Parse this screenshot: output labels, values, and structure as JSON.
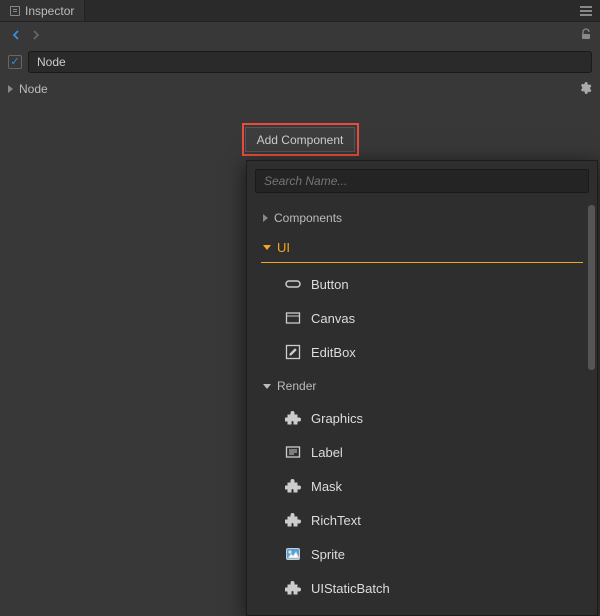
{
  "panel": {
    "title": "Inspector"
  },
  "node": {
    "name": "Node",
    "section": "Node",
    "checked": true
  },
  "addComponent": {
    "label": "Add Component"
  },
  "dropdown": {
    "search_placeholder": "Search Name...",
    "categories": {
      "components": "Components",
      "ui": "UI",
      "render": "Render"
    },
    "ui_items": [
      {
        "label": "Button",
        "icon": "button"
      },
      {
        "label": "Canvas",
        "icon": "canvas"
      },
      {
        "label": "EditBox",
        "icon": "editbox"
      }
    ],
    "render_items": [
      {
        "label": "Graphics",
        "icon": "puzzle"
      },
      {
        "label": "Label",
        "icon": "label"
      },
      {
        "label": "Mask",
        "icon": "puzzle"
      },
      {
        "label": "RichText",
        "icon": "puzzle"
      },
      {
        "label": "Sprite",
        "icon": "sprite"
      },
      {
        "label": "UIStaticBatch",
        "icon": "puzzle"
      }
    ]
  }
}
